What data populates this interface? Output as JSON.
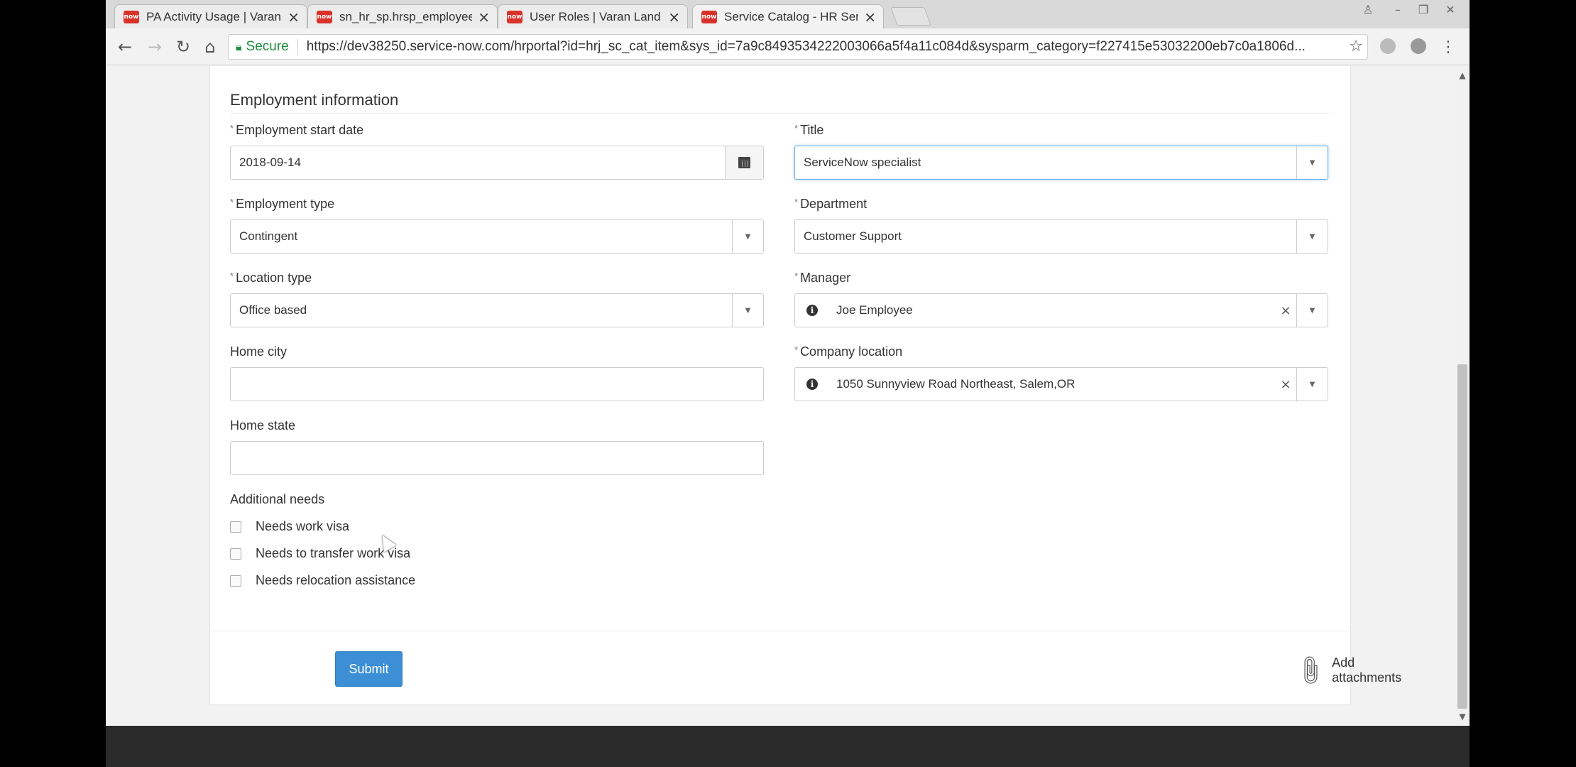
{
  "browser": {
    "tabs": [
      {
        "title": "PA Activity Usage | Varan",
        "favicon": "now"
      },
      {
        "title": "sn_hr_sp.hrsp_employee",
        "favicon": "now"
      },
      {
        "title": "User Roles | Varan Land",
        "favicon": "now"
      },
      {
        "title": "Service Catalog - HR Ser",
        "favicon": "now",
        "active": true
      }
    ],
    "secure_label": "Secure",
    "url": "https://dev38250.service-now.com/hrportal?id=hrj_sc_cat_item&sys_id=7a9c8493534222003066a5f4a11c084d&sysparm_category=f227415e53032200eb7c0a1806d..."
  },
  "form": {
    "section_title": "Employment information",
    "fields": {
      "start_date": {
        "label": "Employment start date",
        "value": "2018-09-14",
        "required": true
      },
      "title": {
        "label": "Title",
        "value": "ServiceNow specialist",
        "required": true
      },
      "employment_type": {
        "label": "Employment type",
        "value": "Contingent",
        "required": true
      },
      "department": {
        "label": "Department",
        "value": "Customer Support",
        "required": true
      },
      "location_type": {
        "label": "Location type",
        "value": "Office based",
        "required": true
      },
      "manager": {
        "label": "Manager",
        "value": "Joe Employee",
        "required": true
      },
      "home_city": {
        "label": "Home city",
        "value": ""
      },
      "company_location": {
        "label": "Company location",
        "value": "1050 Sunnyview Road Northeast, Salem,OR",
        "required": true
      },
      "home_state": {
        "label": "Home state",
        "value": ""
      }
    },
    "additional_needs": {
      "label": "Additional needs",
      "options": [
        {
          "label": "Needs work visa",
          "checked": false
        },
        {
          "label": "Needs to transfer work visa",
          "checked": false
        },
        {
          "label": "Needs relocation assistance",
          "checked": false
        }
      ]
    },
    "required_marker": "*",
    "submit_label": "Submit",
    "attach_label": "Add attachments"
  },
  "colors": {
    "primary": "#3c8fd4",
    "brand_favicon": "#d8322a",
    "secure": "#1e8e3e"
  }
}
